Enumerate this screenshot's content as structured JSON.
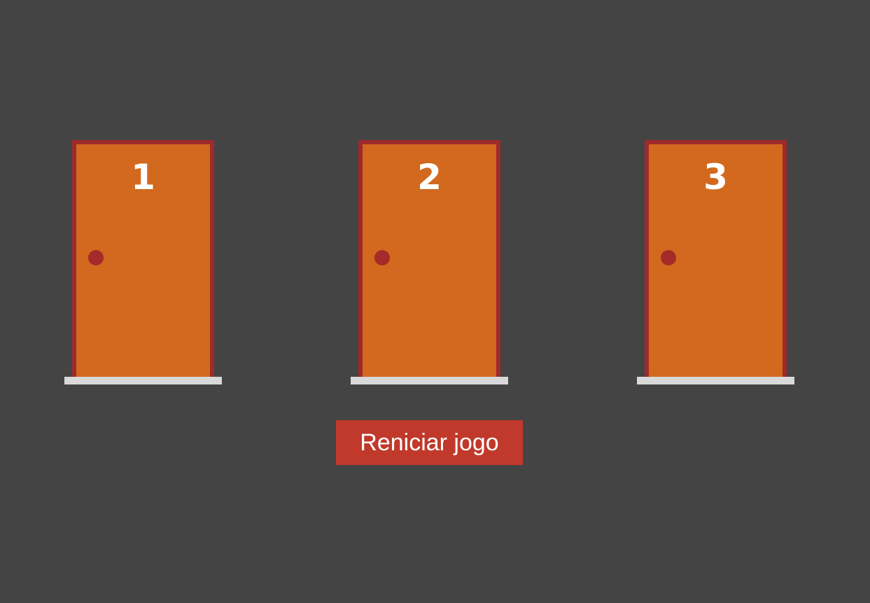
{
  "doors": [
    {
      "number": "1"
    },
    {
      "number": "2"
    },
    {
      "number": "3"
    }
  ],
  "restart_button": {
    "label": "Reniciar jogo"
  },
  "colors": {
    "background": "#444444",
    "door": "#d2691e",
    "frame": "#9e2a2b",
    "knob": "#a52a2a",
    "threshold": "#d9d9d9",
    "button": "#c0392b"
  }
}
